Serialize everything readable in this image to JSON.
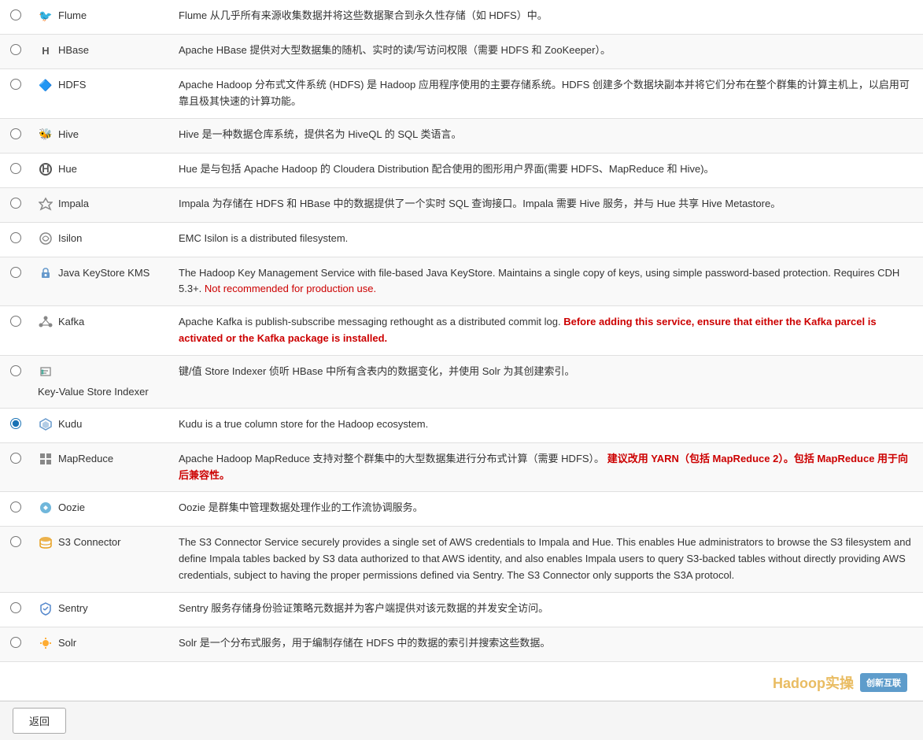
{
  "services": [
    {
      "id": "flume",
      "name": "Flume",
      "icon": "🐦",
      "selected": false,
      "description": "Flume 从几乎所有来源收集数据并将这些数据聚合到永久性存储（如 HDFS）中。",
      "description_extra": null
    },
    {
      "id": "hbase",
      "name": "HBase",
      "icon": "H",
      "selected": false,
      "description": "Apache HBase 提供对大型数据集的随机、实时的读/写访问权限（需要 HDFS 和 ZooKeeper）。",
      "description_extra": null
    },
    {
      "id": "hdfs",
      "name": "HDFS",
      "icon": "🔷",
      "selected": false,
      "description": "Apache Hadoop 分布式文件系统 (HDFS) 是 Hadoop 应用程序使用的主要存储系统。HDFS 创建多个数据块副本并将它们分布在整个群集的计算主机上，以启用可靠且极其快速的计算功能。",
      "description_extra": null
    },
    {
      "id": "hive",
      "name": "Hive",
      "icon": "🐝",
      "selected": false,
      "description": "Hive 是一种数据仓库系统，提供名为 HiveQL 的 SQL 类语言。",
      "description_extra": null
    },
    {
      "id": "hue",
      "name": "Hue",
      "icon": "H",
      "selected": false,
      "description": "Hue 是与包括 Apache Hadoop 的 Cloudera Distribution 配合使用的图形用户界面(需要 HDFS、MapReduce 和 Hive)。",
      "description_extra": null
    },
    {
      "id": "impala",
      "name": "Impala",
      "icon": "🔱",
      "selected": false,
      "description": "Impala 为存储在 HDFS 和 HBase 中的数据提供了一个实时 SQL 查询接口。Impala 需要 Hive 服务，并与 Hue 共享 Hive Metastore。",
      "description_extra": null
    },
    {
      "id": "isilon",
      "name": "Isilon",
      "icon": "🔄",
      "selected": false,
      "description": "EMC Isilon is a distributed filesystem.",
      "description_extra": null
    },
    {
      "id": "java-keystore-kms",
      "name": "Java KeyStore KMS",
      "icon": "🔑",
      "selected": false,
      "description": "The Hadoop Key Management Service with file-based Java KeyStore. Maintains a single copy of keys, using simple password-based protection. Requires CDH 5.3+.",
      "description_red": "Not recommended for production use.",
      "type": "warning"
    },
    {
      "id": "kafka",
      "name": "Kafka",
      "icon": "⚙",
      "selected": false,
      "description": "Apache Kafka is publish-subscribe messaging rethought as a distributed commit log.",
      "description_red": "Before adding this service, ensure that either the Kafka parcel is activated or the Kafka package is installed.",
      "type": "alert"
    },
    {
      "id": "key-value-store-indexer",
      "name": "Key-Value Store Indexer",
      "icon": "🔧",
      "selected": false,
      "description": "键/值 Store Indexer 侦听 HBase 中所有含表内的数据变化，并使用 Solr 为其创建索引。",
      "description_extra": null
    },
    {
      "id": "kudu",
      "name": "Kudu",
      "icon": "🔧",
      "selected": true,
      "description": "Kudu is a true column store for the Hadoop ecosystem.",
      "description_extra": null
    },
    {
      "id": "mapreduce",
      "name": "MapReduce",
      "icon": "▦",
      "selected": false,
      "description": "Apache Hadoop MapReduce 支持对整个群集中的大型数据集进行分布式计算（需要 HDFS）。",
      "description_red": "建议改用 YARN（包括 MapReduce 2）。包括 MapReduce 用于向后兼容性。",
      "type": "warning"
    },
    {
      "id": "oozie",
      "name": "Oozie",
      "icon": "🔵",
      "selected": false,
      "description": "Oozie 是群集中管理数据处理作业的工作流协调服务。",
      "description_extra": null
    },
    {
      "id": "s3-connector",
      "name": "S3 Connector",
      "icon": "☁",
      "selected": false,
      "description": "The S3 Connector Service securely provides a single set of AWS credentials to Impala and Hue. This enables Hue administrators to browse the S3 filesystem and define Impala tables backed by S3 data authorized to that AWS identity, and also enables Impala users to query S3-backed tables without directly providing AWS credentials, subject to having the proper permissions defined via Sentry. The S3 Connector only supports the S3A protocol.",
      "description_extra": null
    },
    {
      "id": "sentry",
      "name": "Sentry",
      "icon": "🔒",
      "selected": false,
      "description": "Sentry 服务存储身份验证策略元数据并为客户端提供对该元数据的并发安全访问。",
      "description_extra": null
    },
    {
      "id": "solr",
      "name": "Solr",
      "icon": "☀",
      "selected": false,
      "description": "Solr 是一个分布式服务，用于编制存储在 HDFS 中的数据的索引并搜索这些数据。",
      "description_extra": null
    }
  ],
  "footer": {
    "back_label": "返回"
  },
  "watermark": {
    "text": "Hadoop实操",
    "logo": "创新互联"
  }
}
